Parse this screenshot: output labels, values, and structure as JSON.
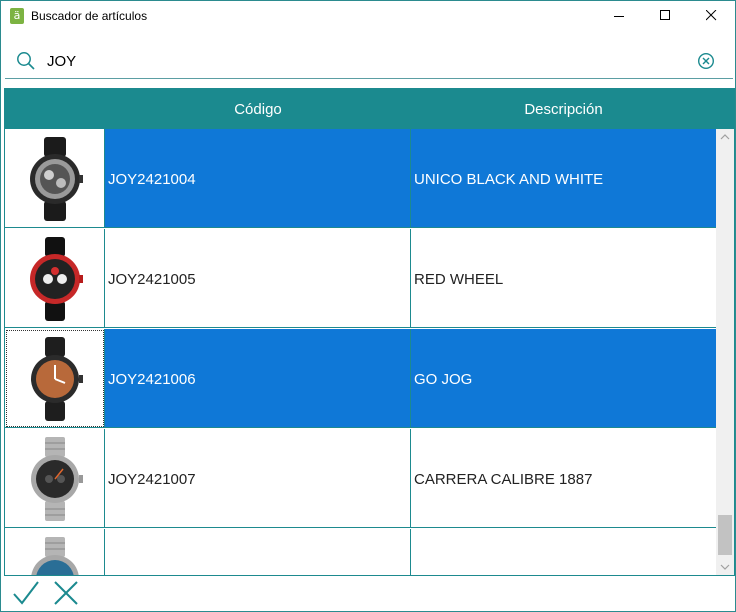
{
  "window": {
    "title": "Buscador de artículos",
    "app_icon_glyph": "ä"
  },
  "search": {
    "value": "JOY",
    "placeholder": ""
  },
  "grid": {
    "columns": [
      "Código",
      "Descripción"
    ],
    "rows": [
      {
        "code": "JOY2421004",
        "description": "UNICO BLACK AND WHITE",
        "selected": true,
        "image": "watch-black-skeleton-icon"
      },
      {
        "code": "JOY2421005",
        "description": "RED WHEEL",
        "selected": false,
        "image": "watch-red-chronograph-icon"
      },
      {
        "code": "JOY2421006",
        "description": "GO JOG",
        "selected": true,
        "focused": true,
        "image": "watch-copper-dial-icon"
      },
      {
        "code": "JOY2421007",
        "description": "CARRERA CALIBRE 1887",
        "selected": false,
        "image": "watch-steel-chronograph-icon"
      },
      {
        "code": "",
        "description": "",
        "selected": false,
        "image": "watch-blue-steel-icon"
      }
    ]
  },
  "colors": {
    "accent": "#1b8a8f",
    "selection": "#0f78d7"
  },
  "actions": {
    "ok_icon": "check-icon",
    "cancel_icon": "x-icon"
  }
}
